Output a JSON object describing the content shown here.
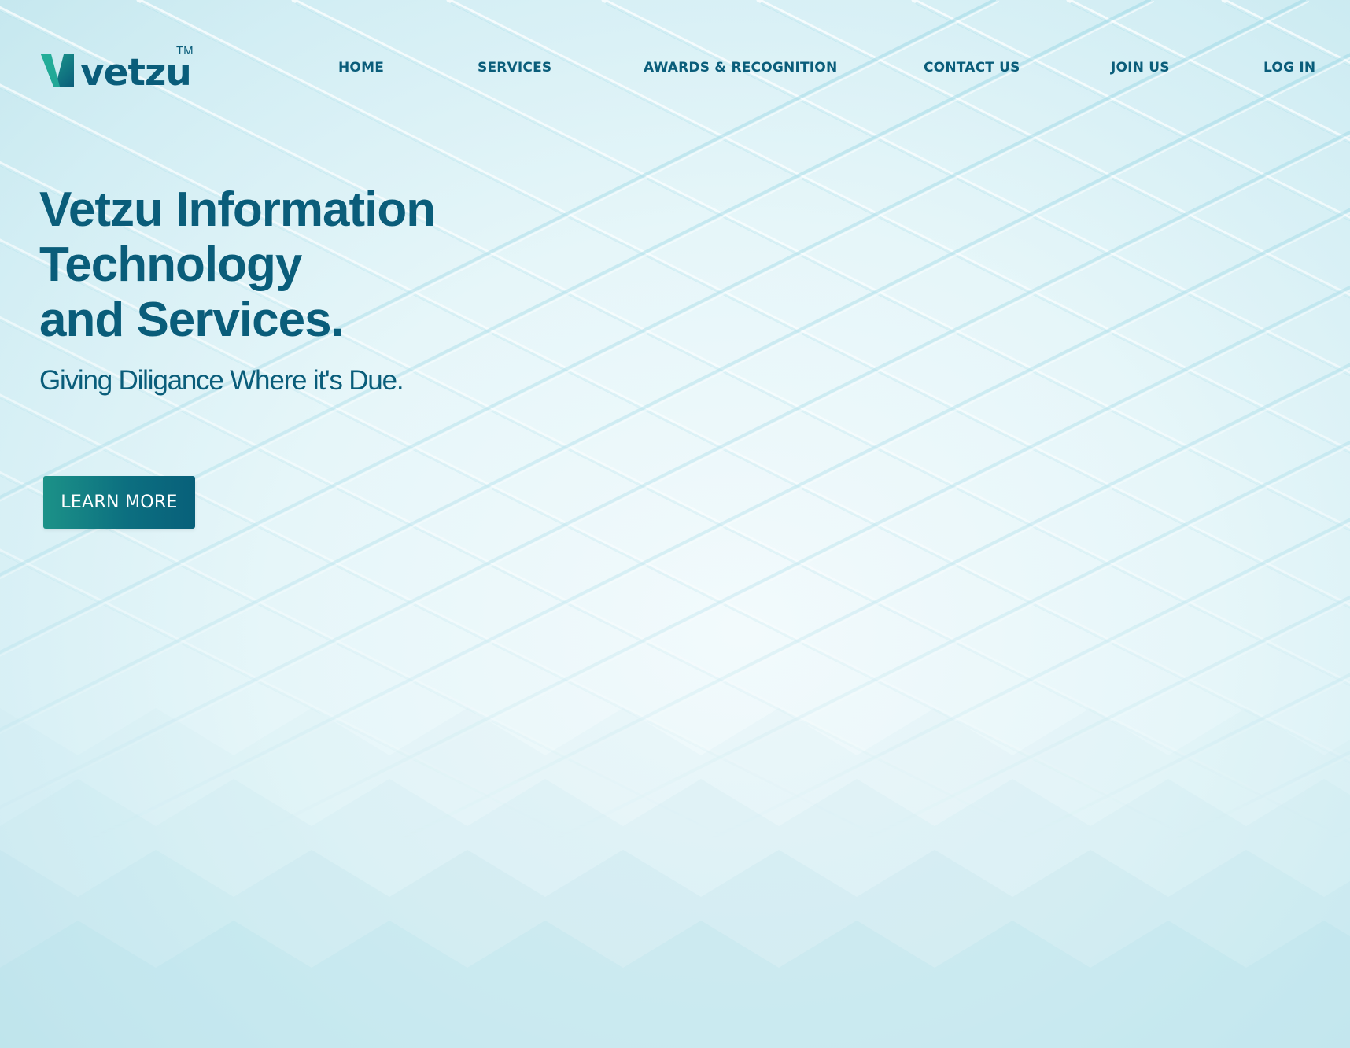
{
  "brand": {
    "name": "vetzu",
    "trademark": "TM",
    "logo_icon": "v-mark-icon"
  },
  "nav": {
    "items": [
      {
        "label": "HOME"
      },
      {
        "label": "SERVICES"
      },
      {
        "label": "AWARDS & RECOGNITION"
      },
      {
        "label": "CONTACT US"
      },
      {
        "label": "JOIN US"
      },
      {
        "label": "LOG IN"
      }
    ]
  },
  "hero": {
    "title_lines": [
      "Vetzu Information",
      "Technology",
      "and Services."
    ],
    "subtitle": "Giving Diligance Where it's Due.",
    "cta_label": "LEARN MORE"
  },
  "colors": {
    "primary": "#0a5d7a",
    "accent": "#1c9288",
    "background": "#e6f6f9",
    "button_text": "#ffffff"
  }
}
